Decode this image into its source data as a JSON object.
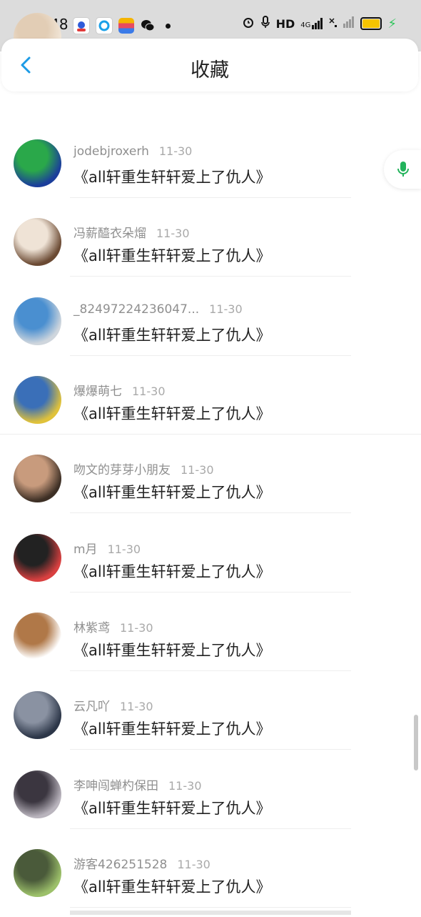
{
  "status_bar": {
    "time": "15:48",
    "apps": [
      "baidu-app-icon",
      "qq-browser-icon",
      "multicolor-app-icon",
      "wechat-icon"
    ],
    "right_icons": [
      "alarm-icon",
      "mic-icon",
      "hd-icon",
      "4g-signal-icon",
      "wifi-off-icon",
      "signal-icon",
      "battery-icon"
    ],
    "hd_label": "HD",
    "network_label": "4G"
  },
  "header": {
    "title": "收藏",
    "back_icon": "chevron-left-icon",
    "accent": "#1c9be6"
  },
  "mic_button": {
    "icon": "microphone-icon",
    "color": "#22b35b"
  },
  "items": [
    {
      "name": "",
      "date": "",
      "text": "《all轩重生轩轩爱上了仇人》",
      "avatar_colors": [
        "#f1e6d8",
        "#e2cdb5"
      ]
    },
    {
      "name": "jodebjroxerh",
      "date": "11-30",
      "text": "《all轩重生轩轩爱上了仇人》",
      "avatar_colors": [
        "#1b3e9b",
        "#2aa84a"
      ]
    },
    {
      "name": "冯薪醯衣朵熘",
      "date": "11-30",
      "text": "《all轩重生轩轩爱上了仇人》",
      "avatar_colors": [
        "#6b4a33",
        "#efe3d6"
      ]
    },
    {
      "name": "_82497224236047...",
      "date": "11-30",
      "text": "《all轩重生轩轩爱上了仇人》",
      "avatar_colors": [
        "#cfd6dd",
        "#4a8fd0"
      ]
    },
    {
      "name": "爆爆萌七",
      "date": "11-30",
      "text": "《all轩重生轩轩爱上了仇人》",
      "avatar_colors": [
        "#e0c23a",
        "#3a6fb8"
      ]
    },
    {
      "name": "吻文的芽芽小朋友",
      "date": "11-30",
      "text": "《all轩重生轩轩爱上了仇人》",
      "avatar_colors": [
        "#3d2f25",
        "#c89b7d"
      ]
    },
    {
      "name": "m月",
      "date": "11-30",
      "text": "《all轩重生轩轩爱上了仇人》",
      "avatar_colors": [
        "#d94040",
        "#222222"
      ]
    },
    {
      "name": "林紫鸢",
      "date": "11-30",
      "text": "《all轩重生轩轩爱上了仇人》",
      "avatar_colors": [
        "#ffffff",
        "#b07848"
      ]
    },
    {
      "name": "云凡吖",
      "date": "11-30",
      "text": "《all轩重生轩轩爱上了仇人》",
      "avatar_colors": [
        "#2c3648",
        "#8a92a2"
      ]
    },
    {
      "name": "李呻闯蝉杓保田",
      "date": "11-30",
      "text": "《all轩重生轩轩爱上了仇人》",
      "avatar_colors": [
        "#b9b4bd",
        "#3b3640"
      ]
    },
    {
      "name": "游客426251528",
      "date": "11-30",
      "text": "《all轩重生轩轩爱上了仇人》",
      "avatar_colors": [
        "#9cc06a",
        "#4a5a3a"
      ]
    }
  ]
}
